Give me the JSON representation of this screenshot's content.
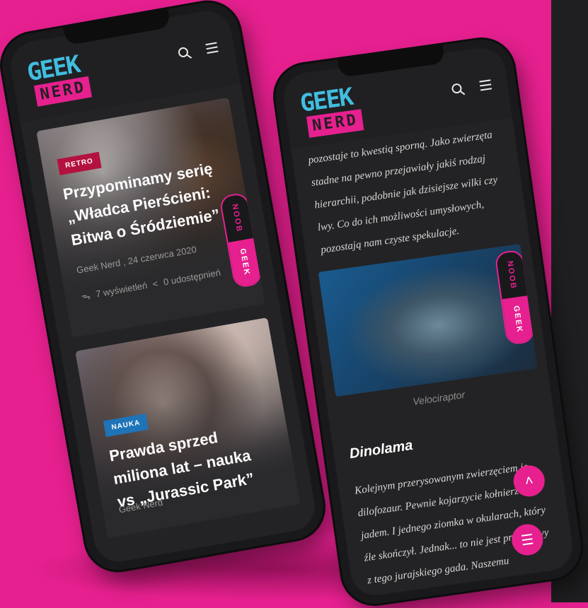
{
  "brand": {
    "logo_top": "GEEK",
    "logo_bottom": "NERD"
  },
  "icons": {
    "search": "search-icon",
    "menu": "hamburger-menu-icon"
  },
  "colors": {
    "accent": "#e6208f",
    "logo_blue": "#41bde0",
    "retro_tag": "#b3123f",
    "nauka_tag": "#1f73b7"
  },
  "phone_left": {
    "cards": [
      {
        "tag": "RETRO",
        "title": "Przypominamy serię „Władca Pierścieni: Bitwa o Śródziemie”",
        "author_date": "Geek Nerd , 24 czerwca 2020",
        "views": "7 wyświetleń",
        "shares": "0 udostępnień"
      },
      {
        "tag": "NAUKA",
        "title": "Prawda sprzed miliona lat – nauka vs „Jurassic Park”",
        "author": "Geek Nerd"
      }
    ],
    "mode_toggle": {
      "noob": "NOOB",
      "geek": "GEEK"
    }
  },
  "phone_right": {
    "intro_text": "pozostaje to kwestią sporną. Jako zwierzęta stadne na pewno przejawiały jakiś rodzaj hierarchii, podobnie jak dzisiejsze wilki czy lwy. Co do ich możliwości umysłowych, pozostają nam czyste spekulacje.",
    "image_caption": "Velociraptor",
    "section_heading": "Dinolama",
    "body_text": "Kolejnym przerysowanym zwierzęciem je dilofozaur. Pewnie kojarzycie kołnierz i pl jadem. I jednego ziomka w okularach, który źle skończył. Jednak... to nie jest prawdziwy  z tego jurajskiego gada. Naszemu bohaterowi",
    "mode_toggle": {
      "noob": "NOOB",
      "geek": "GEEK"
    }
  }
}
